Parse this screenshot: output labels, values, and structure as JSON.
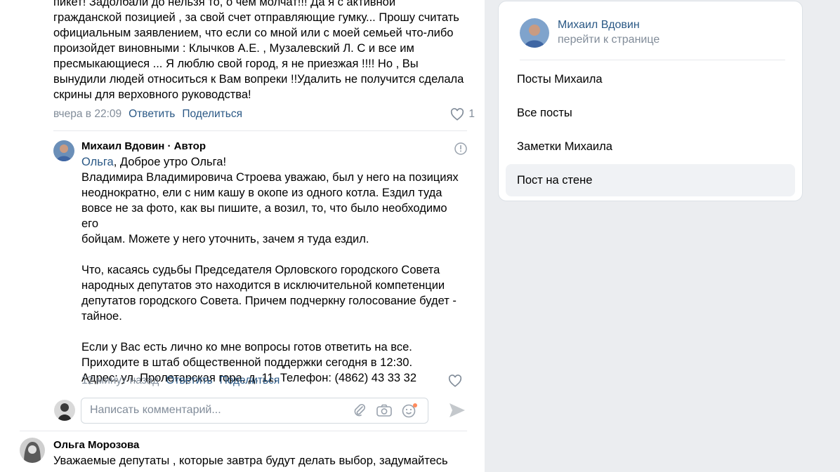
{
  "top_comment": {
    "text": "пикет! Задолбали до нельзя то, о чем молчат!!! Да я с активной\nгражданской позицией , за свой счет отправляющие гумку... Прошу считать\nофициальным заявлением, что если со мной или с моей семьей что-либо\nпроизойдет виновными : Клычков А.Е. , Музалевский Л. С и все им\nпресмыкающиеся ... Я люблю свой город, я не приезжая !!!! Но , Вы\nвынудили людей относиться к Вам вопреки !!Удалить не получится сделала\nскрины для верховного руководства!",
    "time": "вчера в 22:09",
    "reply_label": "Ответить",
    "share_label": "Поделиться",
    "likes": "1"
  },
  "reply": {
    "author": "Михаил Вдовин",
    "author_tag": " · Автор",
    "mention": "Ольга",
    "greeting": ", Доброе утро Ольга!",
    "text": "Владимира Владимировича Строева уважаю, был у него на позициях\nнеоднократно, ели с ним кашу в окопе из одного котла. Ездил туда\nвовсе не за фото, как вы пишите, а возил, то, что было необходимо его\nбойцам. Можете у него уточнить, зачем я туда ездил.\n\nЧто, касаясь судьбы Председателя Орловского городского Совета\nнародных депутатов это находится в исключительной компетенции\nдепутатов городского Совета. Причем подчеркну голосование будет -\nтайное.\n\nЕсли у Вас есть лично ко мне вопросы готов ответить на все.\nПриходите в штаб общественной поддержки сегодня в 12:30.\nАдрес: ул. Пролетарская гора, д. 11. Телефон: (4862) 43 33 32",
    "time": "12 минут назад",
    "reply_label": "Ответить",
    "share_label": "Поделиться"
  },
  "composer": {
    "placeholder": "Написать комментарий..."
  },
  "next_comment": {
    "author": "Ольга Морозова",
    "text": "Уважаемые депутаты , которые завтра будут делать выбор, задумайтесь"
  },
  "sidebar": {
    "owner_name": "Михаил Вдовин",
    "owner_link": "перейти к странице",
    "items": [
      {
        "label": "Посты Михаила"
      },
      {
        "label": "Все посты"
      },
      {
        "label": "Заметки Михаила"
      },
      {
        "label": "Пост на стене"
      }
    ]
  },
  "colors": {
    "link": "#2a5885",
    "secondary": "#818c99",
    "background": "#ebedf0"
  }
}
